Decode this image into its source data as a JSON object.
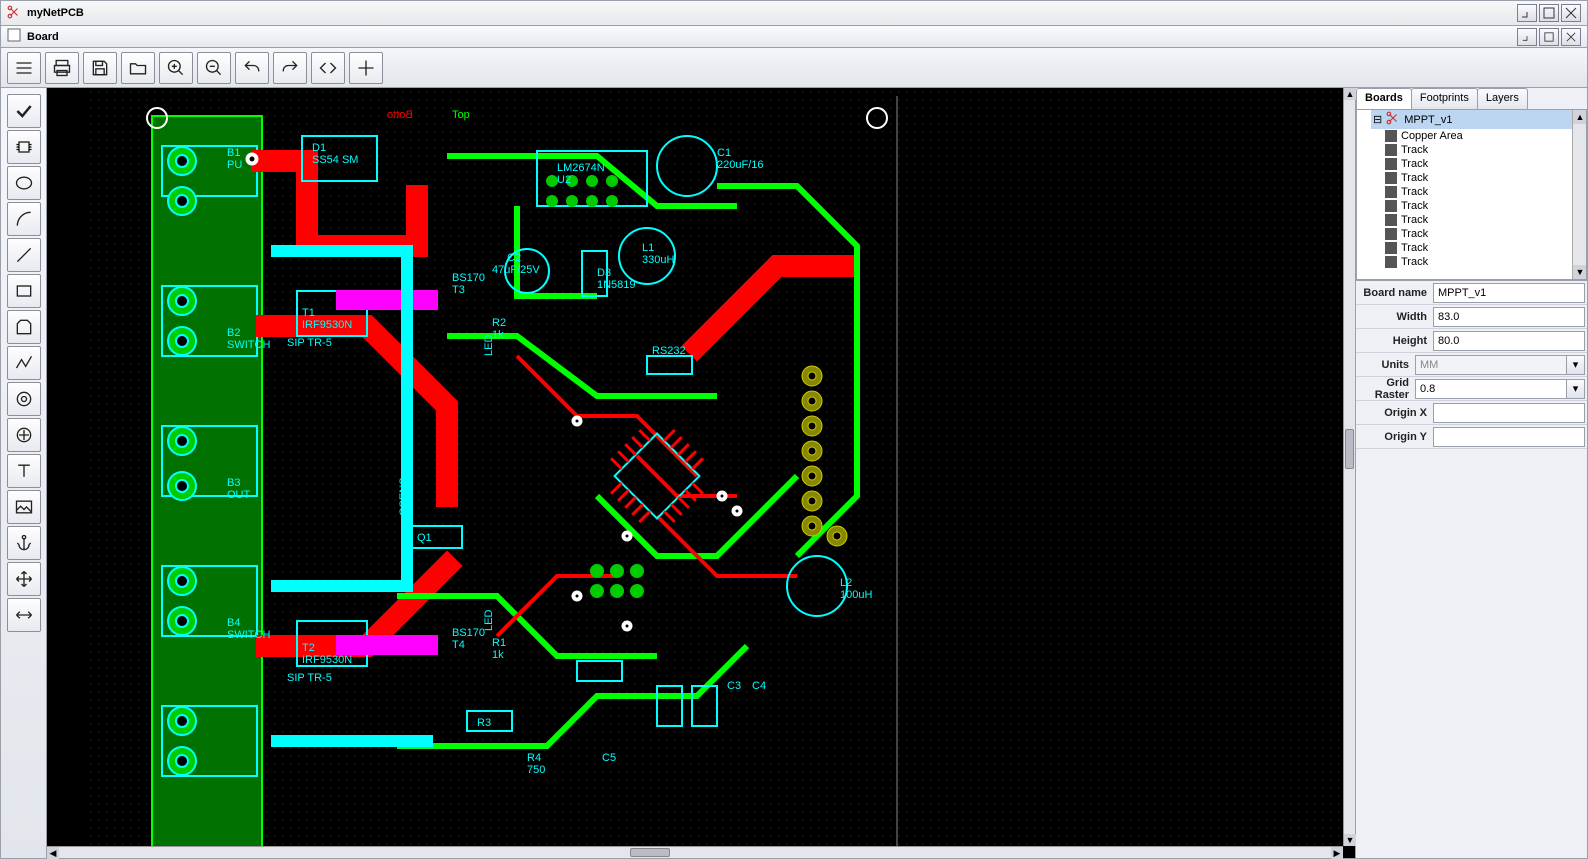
{
  "app": {
    "title": "myNetPCB"
  },
  "subwindow": {
    "title": "Board"
  },
  "tabs": {
    "boards": "Boards",
    "footprints": "Footprints",
    "layers": "Layers",
    "active": "Boards"
  },
  "tree": {
    "root": "MPPT_v1",
    "items": [
      "Copper Area",
      "Track",
      "Track",
      "Track",
      "Track",
      "Track",
      "Track",
      "Track",
      "Track",
      "Track"
    ]
  },
  "props": {
    "board_name_label": "Board name",
    "board_name": "MPPT_v1",
    "width_label": "Width",
    "width": "83.0",
    "height_label": "Height",
    "height": "80.0",
    "units_label": "Units",
    "units": "MM",
    "grid_label": "Grid Raster",
    "grid": "0.8",
    "originx_label": "Origin X",
    "originx": "",
    "originy_label": "Origin Y",
    "originy": ""
  },
  "canvas": {
    "layer_top_label": "Top",
    "layer_bottom_label": "Botto",
    "components": {
      "D1": "D1",
      "D1_val": "SS54 SM",
      "U2": "U2",
      "U2_val": "LM2674N",
      "C1": "C1",
      "C1_val": "220uF/16",
      "L1": "L1",
      "L1_val": "330uH",
      "C2": "C2",
      "C2_val": "47uF/25V",
      "D3": "D3",
      "D3_val": "1N5819",
      "T1": "T1",
      "T1_val": "IRF9530N",
      "T2": "T2",
      "T2_val": "IRF9530N",
      "T3_val": "BS170",
      "T3": "T3",
      "T4_val": "BS170",
      "T4": "T4",
      "R1": "R1",
      "R1_val": "1k",
      "R2": "R2",
      "R2_val": "1k",
      "R3": "R3",
      "R3_val": "",
      "R4": "R4",
      "R4_val": "750",
      "C3": "C3",
      "C4": "C4",
      "C5": "C5",
      "L2": "L2",
      "L2_val": "100uH",
      "RS232": "RS232",
      "LED": "LED",
      "B1": "B1",
      "B1_val": "PU",
      "B2": "B2",
      "B2_val": "SWITCH",
      "B3": "B3",
      "B3_val": "OUT",
      "B4": "B4",
      "B4_val": "SWITCH",
      "SIP": "SIP TR-5",
      "Q1": "Q1",
      "GSENS": "GSENS"
    }
  }
}
